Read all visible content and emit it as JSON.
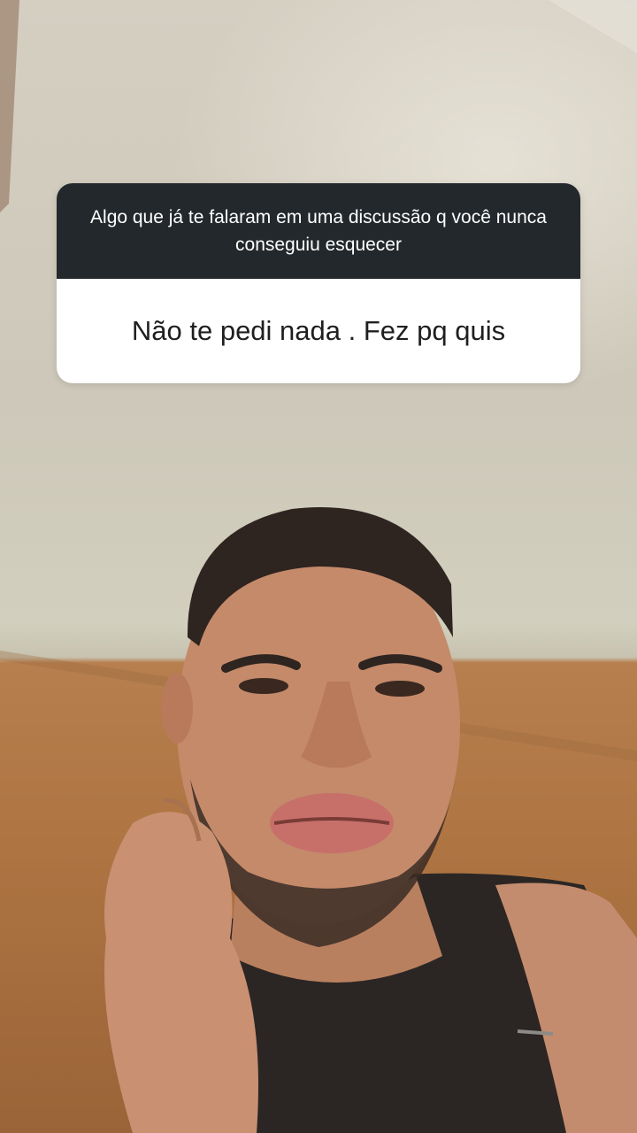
{
  "question_sticker": {
    "question": "Algo que já te falaram em uma discussão q você nunca conseguiu esquecer",
    "answer": "Não te pedi nada . Fez pq quis"
  },
  "colors": {
    "sticker_header": "#23282c",
    "sticker_body": "#ffffff",
    "wall": "#d2cfbe",
    "wood_panel": "#ae7442"
  }
}
